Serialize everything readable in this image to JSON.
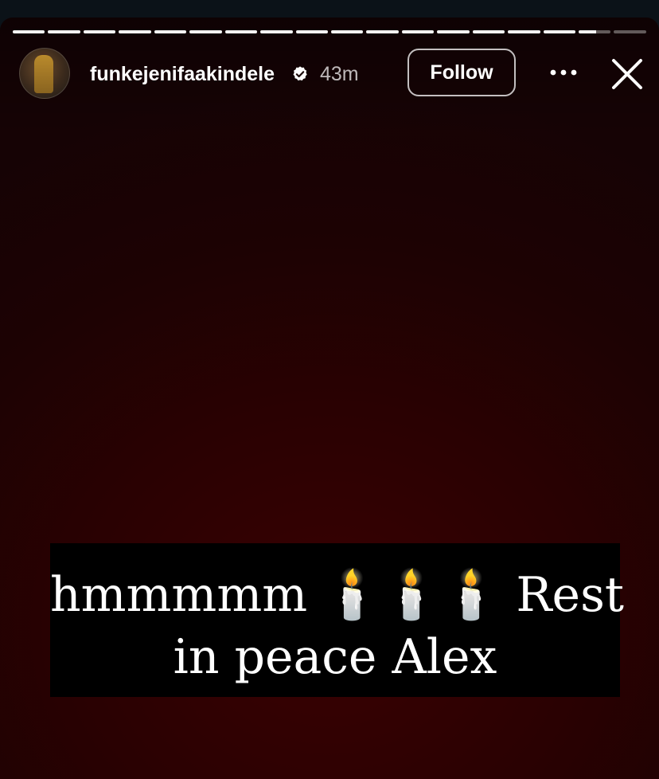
{
  "story": {
    "progress": {
      "segments": 18,
      "active_index": 16,
      "active_fraction": 0.55
    },
    "user": {
      "username": "funkejenifaakindele",
      "verified": true,
      "time_ago": "43m",
      "avatar_icon": "profile-avatar"
    },
    "actions": {
      "follow_label": "Follow",
      "more_icon": "more-horizontal-icon",
      "close_icon": "close-icon"
    },
    "caption": {
      "line1": "hmmmmm 🕯️🕯️🕯️ Rest",
      "line2": "in peace Alex"
    },
    "colors": {
      "background": "#2a0102",
      "caption_bg": "#000000",
      "text": "#ffffff",
      "verified_badge": "#ffffff"
    }
  }
}
